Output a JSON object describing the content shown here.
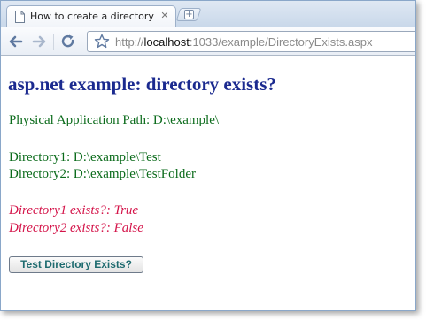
{
  "browser": {
    "tab": {
      "title": "How to create a directory ...",
      "close_glyph": "✕",
      "favicon": "page-icon"
    },
    "new_tab_glyph": "+",
    "address": {
      "scheme": "http://",
      "host": "localhost",
      "path": ":1033/example/DirectoryExists.aspx"
    },
    "icons": [
      "back-arrow-icon",
      "forward-arrow-icon",
      "reload-icon",
      "star-icon"
    ]
  },
  "page": {
    "title": "asp.net example: directory exists?",
    "physical_path": "Physical Application Path: D:\\example\\",
    "directory1": "Directory1: D:\\example\\Test",
    "directory2": "Directory2: D:\\example\\TestFolder",
    "result1": "Directory1 exists?: True",
    "result2": "Directory2 exists?: False",
    "button_label": "Test Directory Exists?"
  },
  "colors": {
    "title": "#1b2a8f",
    "info_text": "#0b6b1b",
    "result_text": "#d4154a",
    "button_text": "#1e6b6f"
  }
}
